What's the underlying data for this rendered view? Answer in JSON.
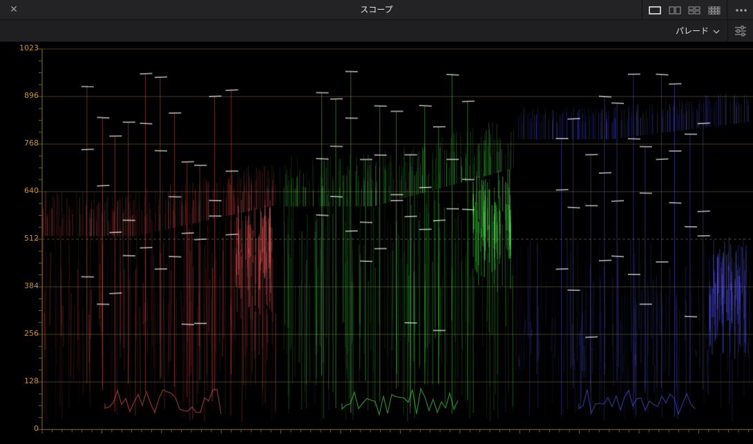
{
  "window": {
    "title": "スコープ",
    "close_icon": "close-icon",
    "more_icon": "more-horizontal-icon",
    "layouts": [
      {
        "icon": "single-layout-icon",
        "selected": true
      },
      {
        "icon": "dual-layout-icon",
        "selected": false
      },
      {
        "icon": "quad-layout-icon",
        "selected": false
      },
      {
        "icon": "grid-layout-icon",
        "selected": false
      }
    ]
  },
  "toolbar": {
    "scope_mode": "パレード",
    "settings_icon": "settings-sliders-icon"
  },
  "scope": {
    "y_ticks": [
      "1023",
      "896",
      "768",
      "640",
      "512",
      "384",
      "256",
      "128",
      "0"
    ],
    "label_color": "#c9922e",
    "channels": [
      {
        "name": "red",
        "color": "#ff5a5a"
      },
      {
        "name": "green",
        "color": "#4dff4d"
      },
      {
        "name": "blue",
        "color": "#5a5aff"
      }
    ]
  }
}
